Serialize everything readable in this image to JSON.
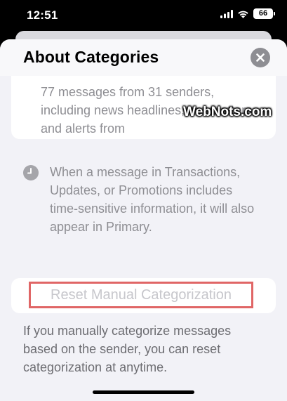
{
  "status_bar": {
    "time": "12:51",
    "battery": "66",
    "icons": [
      "signal-icon",
      "wifi-icon",
      "battery-icon"
    ]
  },
  "sheet": {
    "title": "About Categories",
    "close_icon": "close-icon",
    "card_text": "77 messages from 31 senders, including news headlines, newsletters, and alerts from",
    "info": {
      "icon": "clock-icon",
      "text": "When a message in Transactions, Updates, or Promotions includes time-sensitive information, it will also appear in Primary."
    },
    "reset_button_label": "Reset Manual Categorization",
    "footer_text": "If you manually categorize messages based on the sender, you can reset categorization at anytime."
  },
  "watermark": "WebNots.com",
  "colors": {
    "highlight_border": "#e06666",
    "sheet_background": "#f2f2f7",
    "secondary_text": "#8e8e93",
    "disabled_text": "#c7c7cc"
  }
}
